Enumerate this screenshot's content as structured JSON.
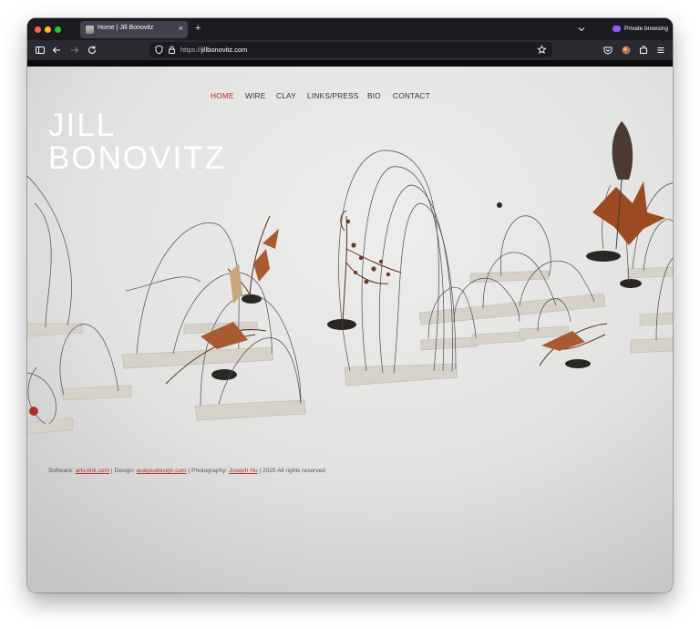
{
  "browser": {
    "tab_title": "Home | Jill Bonovitz",
    "tab_close": "×",
    "new_tab": "+",
    "private_label": "Private browsing",
    "url_protocol": "https://",
    "url_host": "jillbonovitz.com",
    "icons": [
      "sidebar-icon",
      "back-icon",
      "forward-icon",
      "reload-icon",
      "shield-icon",
      "lock-icon",
      "bookmark-star-icon",
      "pocket-icon",
      "avatar-icon",
      "extensions-icon",
      "menu-icon",
      "chevron-down-icon"
    ]
  },
  "site": {
    "nav": [
      {
        "label": "HOME",
        "active": true
      },
      {
        "label": "WIRE",
        "active": false
      },
      {
        "label": "CLAY",
        "active": false
      },
      {
        "label": "LINKS/PRESS",
        "active": false
      },
      {
        "label": "BIO",
        "active": false
      },
      {
        "label": "CONTACT",
        "active": false
      }
    ],
    "title_line1": "JILL",
    "title_line2": "BONOVITZ",
    "footer": {
      "software_label": "Software:",
      "software_link": "arts-link.com",
      "design_label": "| Design:",
      "design_link": "avayoudesign.com",
      "photo_label": "| Photography:",
      "photo_link": "Joseph Hu",
      "rights": "| 2025 All rights reserved"
    }
  },
  "colors": {
    "accent_red": "#c0291f",
    "link_red": "#b5302a",
    "chrome_dark": "#1c1b22",
    "toolbar": "#2b2a33",
    "page_bg": "#e3e3e2"
  }
}
